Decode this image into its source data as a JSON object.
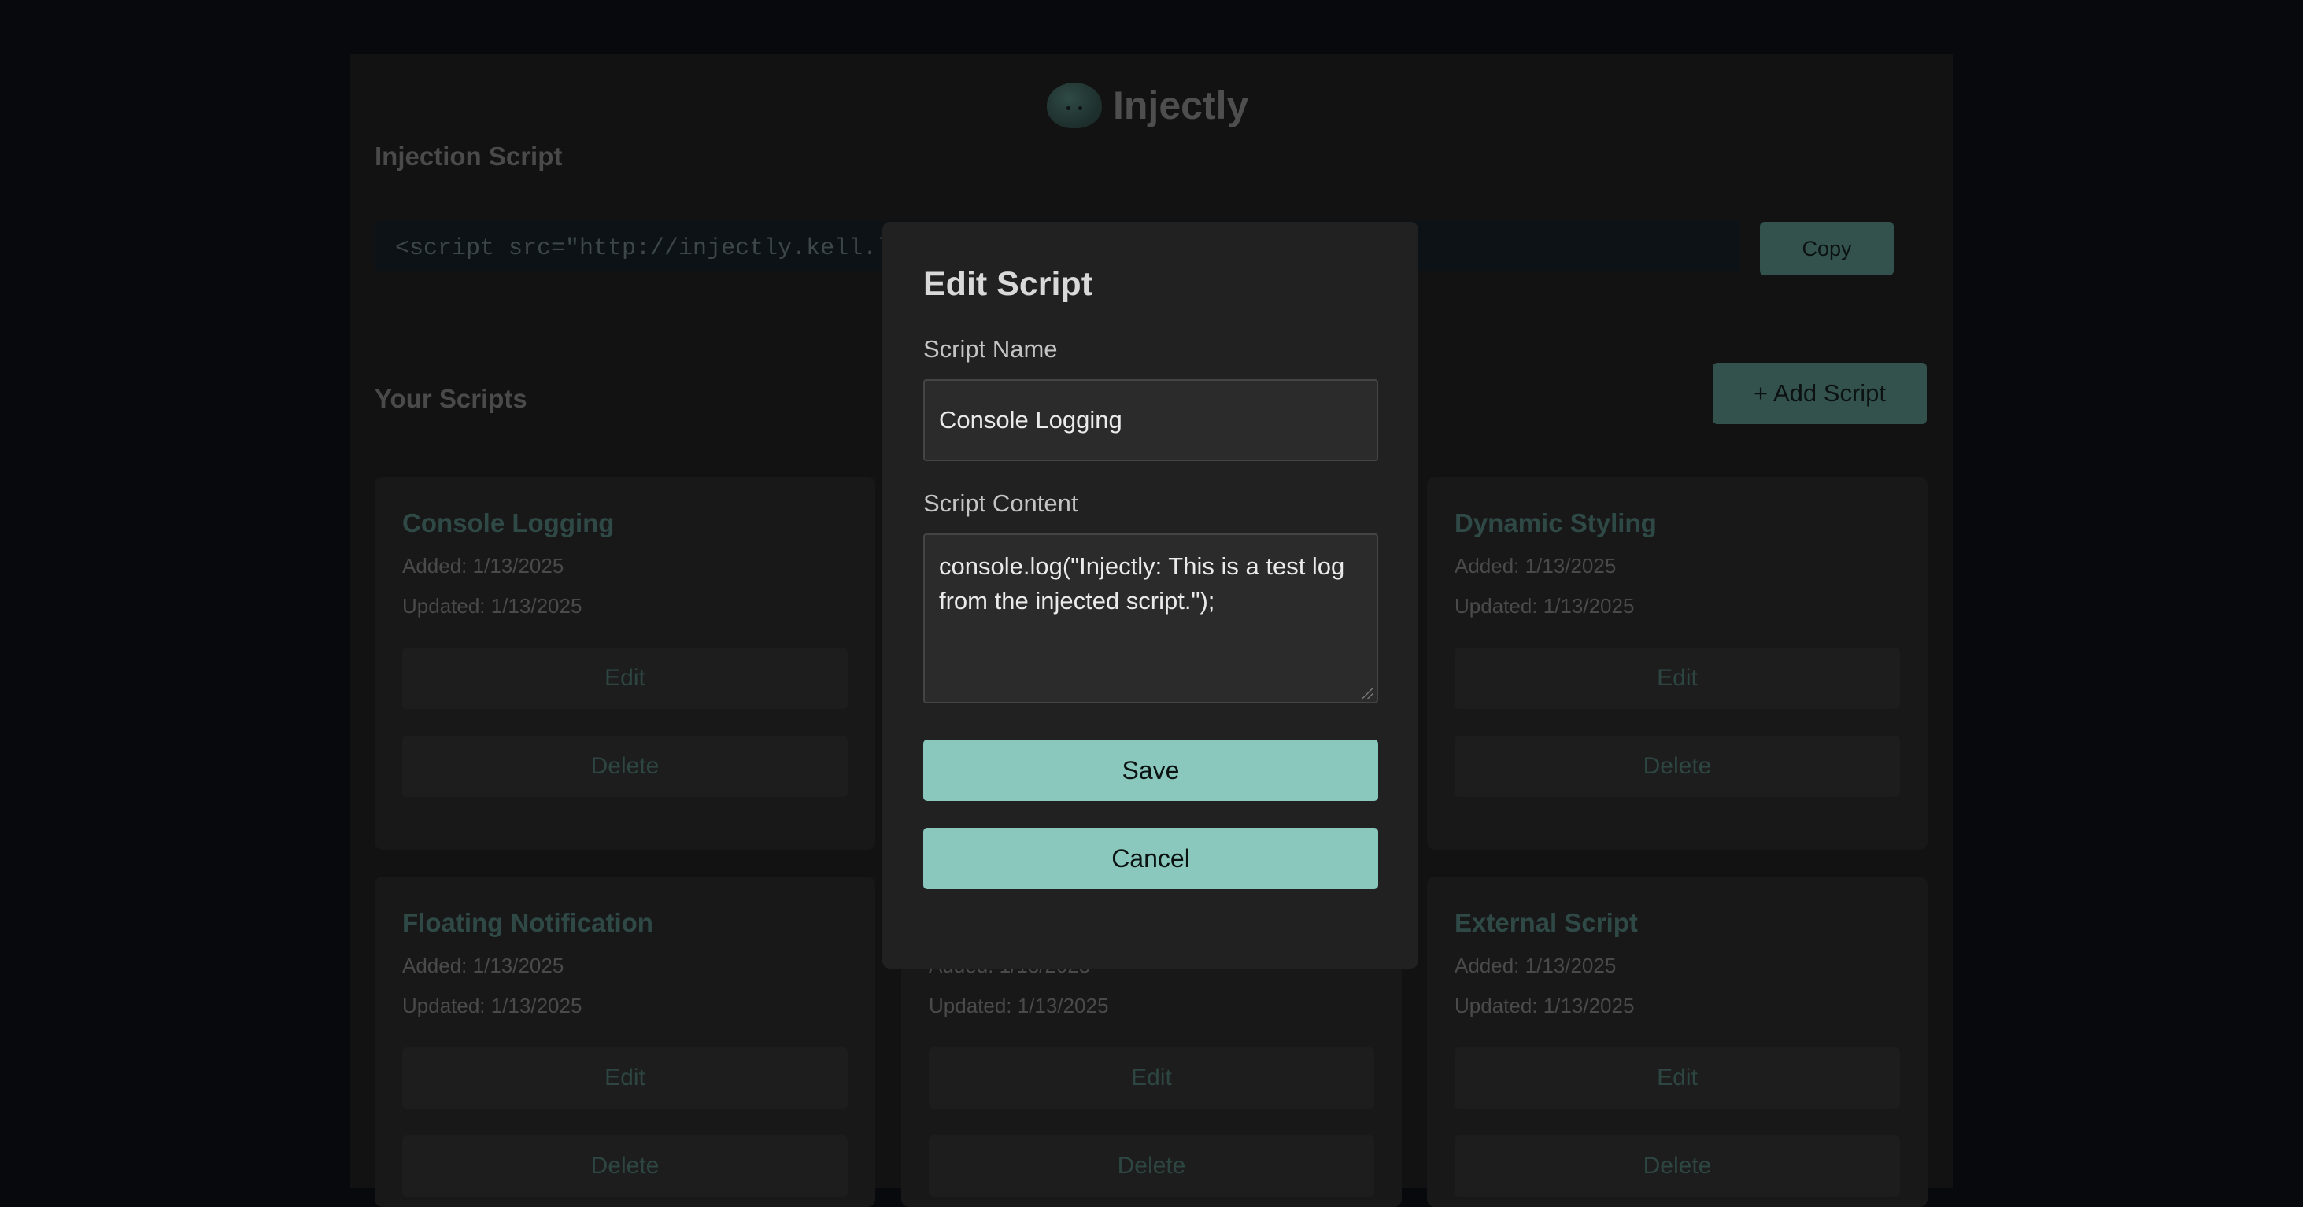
{
  "app": {
    "name": "Injectly"
  },
  "injection": {
    "title": "Injection Script",
    "code": "<script src=\"http://injectly.kell.l",
    "copy_label": "Copy"
  },
  "scripts": {
    "title": "Your Scripts",
    "add_label": "+ Add Script",
    "edit_label": "Edit",
    "delete_label": "Delete",
    "cards": [
      {
        "name": "Console Logging",
        "added": "Added: 1/13/2025",
        "updated": "Updated: 1/13/2025"
      },
      {
        "name": "Dynamic Styling",
        "added": "Added: 1/13/2025",
        "updated": "Updated: 1/13/2025"
      },
      {
        "name": "Floating Notification",
        "added": "Added: 1/13/2025",
        "updated": "Updated: 1/13/2025"
      },
      {
        "name": "",
        "added": "Added: 1/13/2025",
        "updated": "Updated: 1/13/2025"
      },
      {
        "name": "External Script",
        "added": "Added: 1/13/2025",
        "updated": "Updated: 1/13/2025"
      }
    ]
  },
  "modal": {
    "title": "Edit Script",
    "name_label": "Script Name",
    "name_value": "Console Logging",
    "content_label": "Script Content",
    "content_value": "console.log(\"Injectly: This is a test log from the injected script.\");",
    "save_label": "Save",
    "cancel_label": "Cancel"
  },
  "colors": {
    "accent": "#8ac8be",
    "modal_bg": "#212121",
    "page_bg": "#07090d"
  }
}
